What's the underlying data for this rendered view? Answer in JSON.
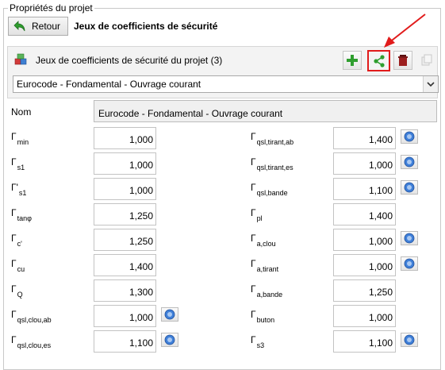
{
  "groupbox": {
    "title": "Propriétés du projet"
  },
  "header": {
    "back_label": "Retour",
    "title": "Jeux de coefficients de sécurité"
  },
  "sets_panel": {
    "label": "Jeux de coefficients de sécurité du projet (3)",
    "selected": "Eurocode - Fondamental - Ouvrage courant",
    "toolbar": {
      "add_icon": "plus-icon",
      "share_icon": "share-icon",
      "delete_icon": "trash-icon",
      "copy_icon": "copy-icon"
    }
  },
  "name_row": {
    "label": "Nom",
    "value": "Eurocode - Fondamental - Ouvrage courant"
  },
  "symbol": "Γ",
  "left_coeffs": [
    {
      "sub": "min",
      "value": "1,000"
    },
    {
      "sub": "s1",
      "value": "1,000"
    },
    {
      "sub": "s1",
      "prime": "'",
      "value": "1,000"
    },
    {
      "sub": "tanφ",
      "value": "1,250"
    },
    {
      "sub": "c'",
      "value": "1,250"
    },
    {
      "sub": "cu",
      "value": "1,400"
    },
    {
      "sub": "Q",
      "value": "1,300"
    },
    {
      "sub": "qsl,clou,ab",
      "value": "1,000",
      "info": true
    },
    {
      "sub": "qsl,clou,es",
      "value": "1,100",
      "info": true
    }
  ],
  "right_coeffs": [
    {
      "sub": "qsl,tirant,ab",
      "value": "1,400",
      "info": true
    },
    {
      "sub": "qsl,tirant,es",
      "value": "1,000",
      "info": true
    },
    {
      "sub": "qsl,bande",
      "value": "1,100",
      "info": true
    },
    {
      "sub": "pl",
      "value": "1,400"
    },
    {
      "sub": "a,clou",
      "value": "1,000",
      "info": true
    },
    {
      "sub": "a,tirant",
      "value": "1,000",
      "info": true
    },
    {
      "sub": "a,bande",
      "value": "1,250"
    },
    {
      "sub": "buton",
      "value": "1,000"
    },
    {
      "sub": "s3",
      "value": "1,100",
      "info": true
    }
  ],
  "colors": {
    "accent_green": "#2f9e2f",
    "annotation_red": "#e11b1b",
    "delete_red": "#9c1f1f",
    "info_blue": "#3f7fd8"
  }
}
